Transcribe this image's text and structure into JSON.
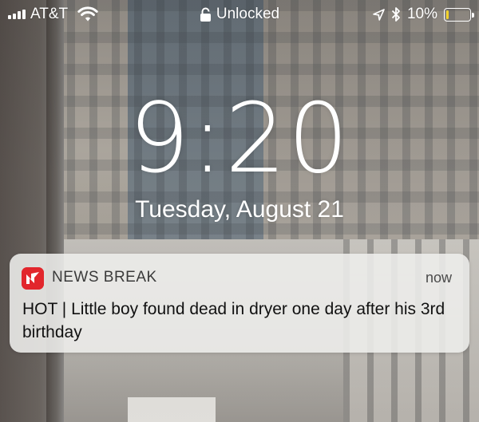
{
  "status_bar": {
    "carrier": "AT&T",
    "lock_status": "Unlocked",
    "battery_percent": "10%",
    "battery_level": 0.1,
    "battery_color": "#f1d12a",
    "icons": [
      "signal-icon",
      "wifi-icon",
      "lock-icon",
      "location-icon",
      "bluetooth-icon",
      "battery-icon"
    ]
  },
  "lock_screen": {
    "time": "9:20",
    "date": "Tuesday, August 21"
  },
  "notification": {
    "app_name": "NEWS BREAK",
    "app_icon": "news-break-icon",
    "app_icon_color": "#e2262c",
    "time": "now",
    "message": "HOT | Little boy found dead in dryer one day after his 3rd birthday"
  }
}
